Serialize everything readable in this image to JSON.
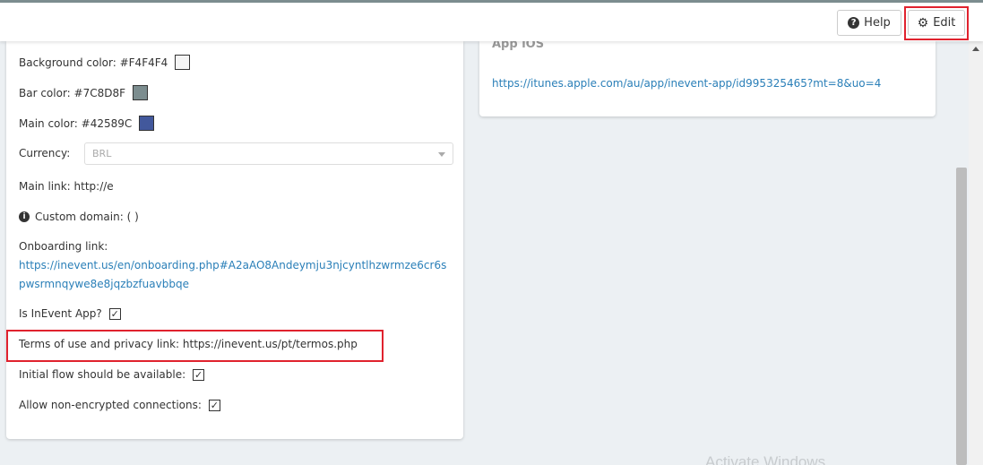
{
  "header": {
    "help_label": "Help",
    "edit_label": "Edit"
  },
  "settings": {
    "background_color_label": "Background color: #F4F4F4",
    "background_color": "#F4F4F4",
    "bar_color_label": "Bar color: #7C8D8F",
    "bar_color": "#7C8D8F",
    "main_color_label": "Main color: #42589C",
    "main_color": "#42589C",
    "currency_label": "Currency:",
    "currency_value": "BRL",
    "main_link": "Main link: http://e",
    "custom_domain": "Custom domain: ( )",
    "onboarding_label": "Onboarding link:",
    "onboarding_url": "https://inevent.us/en/onboarding.php#A2aAO8Andeymju3njcyntlhzwrmze6cr6spwsrmnqywe8e8jqzbzfuavbbqe",
    "is_inevent_app_label": "Is InEvent App?",
    "is_inevent_app": true,
    "terms_link": "Terms of use and privacy link: https://inevent.us/pt/termos.php",
    "initial_flow_label": "Initial flow should be available:",
    "initial_flow": true,
    "non_encrypted_label": "Allow non-encrypted connections:",
    "non_encrypted": true
  },
  "app_ios": {
    "title": "App iOS",
    "link": "https://itunes.apple.com/au/app/inevent-app/id995325465?mt=8&uo=4"
  },
  "os_watermark": "Activate Windows",
  "colors": {
    "highlight": "#e0222e",
    "link": "#2a7fb8"
  }
}
